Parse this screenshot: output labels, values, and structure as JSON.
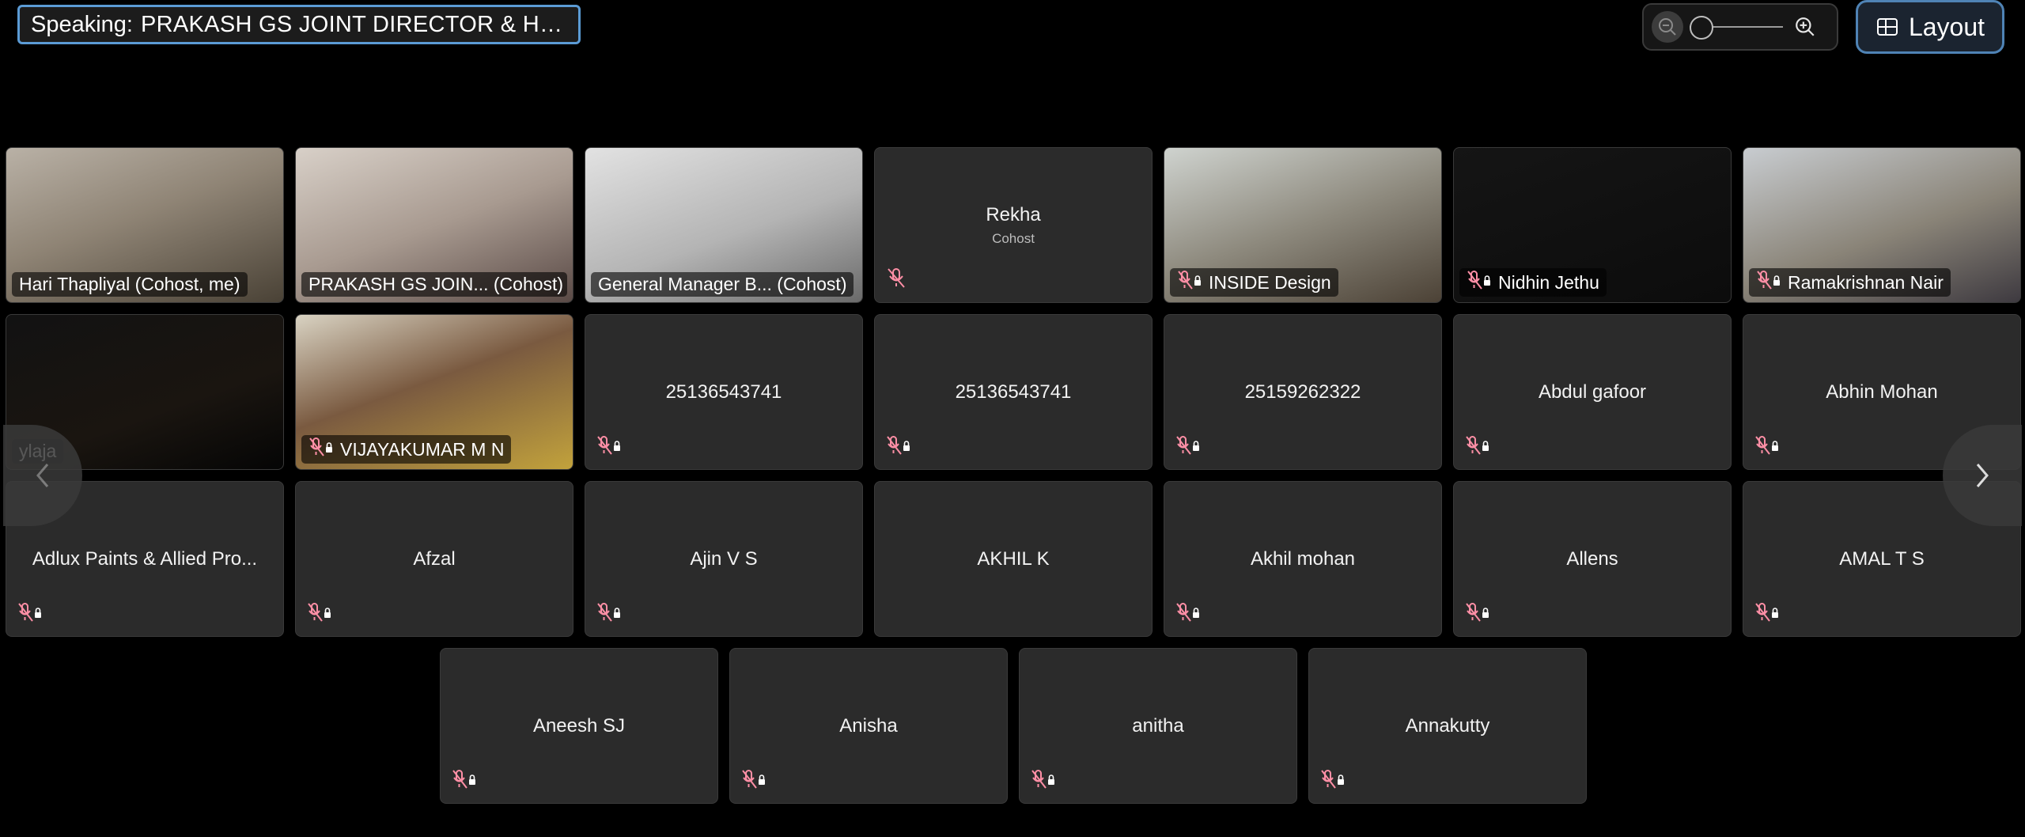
{
  "speaking": {
    "label": "Speaking:",
    "name": "PRAKASH GS JOINT DIRECTOR & HEAD O..."
  },
  "zoom": {
    "level": 0
  },
  "layout_label": "Layout",
  "tiles": [
    {
      "name": "Hari Thapliyal (Cohost, me)"
    },
    {
      "name": "PRAKASH GS JOIN... (Cohost)"
    },
    {
      "name": "General Manager B... (Cohost)"
    },
    {
      "name": "Rekha",
      "subtitle": "Cohost"
    },
    {
      "name": "INSIDE Design"
    },
    {
      "name": "Nidhin Jethu"
    },
    {
      "name": "Ramakrishnan Nair"
    },
    {
      "name": "ylaja"
    },
    {
      "name": "VIJAYAKUMAR M N"
    },
    {
      "name": "25136543741"
    },
    {
      "name": "25136543741"
    },
    {
      "name": "25159262322"
    },
    {
      "name": "Abdul gafoor"
    },
    {
      "name": "Abhin Mohan"
    },
    {
      "name": "Adlux Paints & Allied Pro..."
    },
    {
      "name": "Afzal"
    },
    {
      "name": "Ajin V S"
    },
    {
      "name": "AKHIL K"
    },
    {
      "name": "Akhil mohan"
    },
    {
      "name": "Allens"
    },
    {
      "name": "AMAL T S"
    },
    {
      "name": "Aneesh SJ"
    },
    {
      "name": "Anisha"
    },
    {
      "name": "anitha"
    },
    {
      "name": "Annakutty"
    }
  ]
}
